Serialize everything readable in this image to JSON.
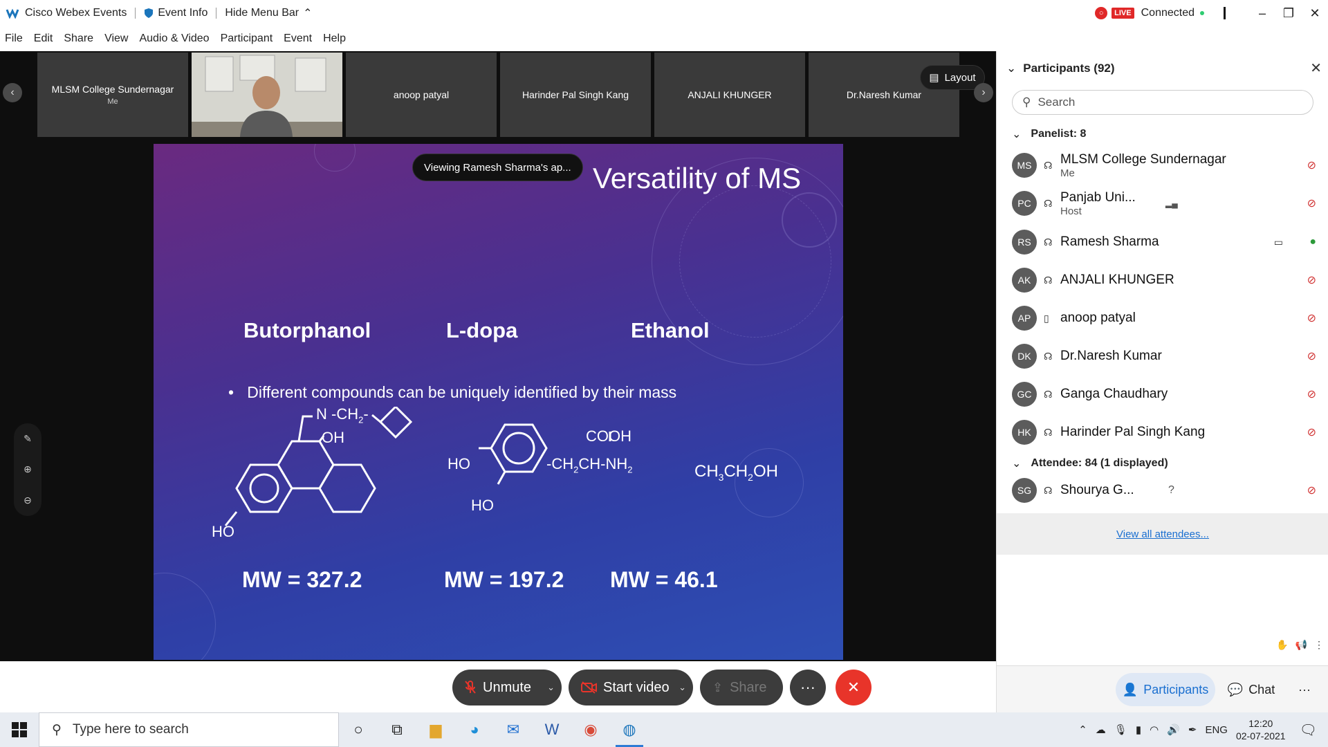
{
  "titlebar": {
    "app_name": "Cisco Webex Events",
    "event_info": "Event Info",
    "hide_menu": "Hide Menu Bar",
    "live": "LIVE",
    "status": "Connected"
  },
  "menubar": {
    "items": [
      "File",
      "Edit",
      "Share",
      "View",
      "Audio & Video",
      "Participant",
      "Event",
      "Help"
    ]
  },
  "filmstrip": {
    "tiles": [
      {
        "name": "MLSM College Sundernagar",
        "sub": "Me"
      },
      {
        "name": "",
        "sub": ""
      },
      {
        "name": "anoop patyal",
        "sub": ""
      },
      {
        "name": "Harinder Pal Singh Kang",
        "sub": ""
      },
      {
        "name": "ANJALI KHUNGER",
        "sub": ""
      },
      {
        "name": "Dr.Naresh Kumar",
        "sub": ""
      }
    ],
    "layout_label": "Layout"
  },
  "share": {
    "viewing": "Viewing Ramesh Sharma's ap..."
  },
  "slide": {
    "title": "Versatility of MS",
    "compounds": [
      "Butorphanol",
      "L-dopa",
      "Ethanol"
    ],
    "bullet": "Different compounds can be uniquely identified by their mass",
    "labels": {
      "n_ch2": "N -CH",
      "oh": "OH",
      "ho1": "HO",
      "cooh": "COOH",
      "ho2": "HO",
      "ch2ch": "-CH",
      "ch_nh": "CH-NH",
      "ho3": "HO",
      "ethanol_formula": "CH",
      "sub2": "2",
      "sub3": "3",
      "ch2oh": "CH",
      "oh_end": "OH"
    },
    "mw": [
      "MW = 327.2",
      "MW = 197.2",
      "MW = 46.1"
    ]
  },
  "controls": {
    "unmute": "Unmute",
    "start_video": "Start video",
    "share": "Share",
    "more": "···"
  },
  "panel": {
    "title": "Participants (92)",
    "search_placeholder": "Search",
    "panelist_header": "Panelist: 8",
    "attendee_header": "Attendee: 84 (1 displayed)",
    "panelists": [
      {
        "initials": "MS",
        "name": "MLSM College Sundernagar",
        "role": "Me"
      },
      {
        "initials": "PC",
        "name": "Panjab Uni...",
        "role": "Host"
      },
      {
        "initials": "RS",
        "name": "Ramesh Sharma",
        "role": ""
      },
      {
        "initials": "AK",
        "name": "ANJALI KHUNGER",
        "role": ""
      },
      {
        "initials": "AP",
        "name": "anoop patyal",
        "role": ""
      },
      {
        "initials": "DK",
        "name": "Dr.Naresh Kumar",
        "role": ""
      },
      {
        "initials": "GC",
        "name": "Ganga Chaudhary",
        "role": ""
      },
      {
        "initials": "HK",
        "name": "Harinder Pal Singh Kang",
        "role": ""
      }
    ],
    "attendees": [
      {
        "initials": "SG",
        "name": "Shourya G...",
        "role": ""
      }
    ],
    "unknown_mark": "?",
    "view_all": "View all attendees...",
    "footer_participants": "Participants",
    "footer_chat": "Chat",
    "footer_more": "···"
  },
  "taskbar": {
    "search_placeholder": "Type here to search",
    "language": "ENG",
    "time": "12:20",
    "date": "02-07-2021"
  },
  "colors": {
    "accent": "#1a6fd0",
    "live": "#e02828",
    "end": "#e8342a",
    "muted": "#d03030"
  }
}
